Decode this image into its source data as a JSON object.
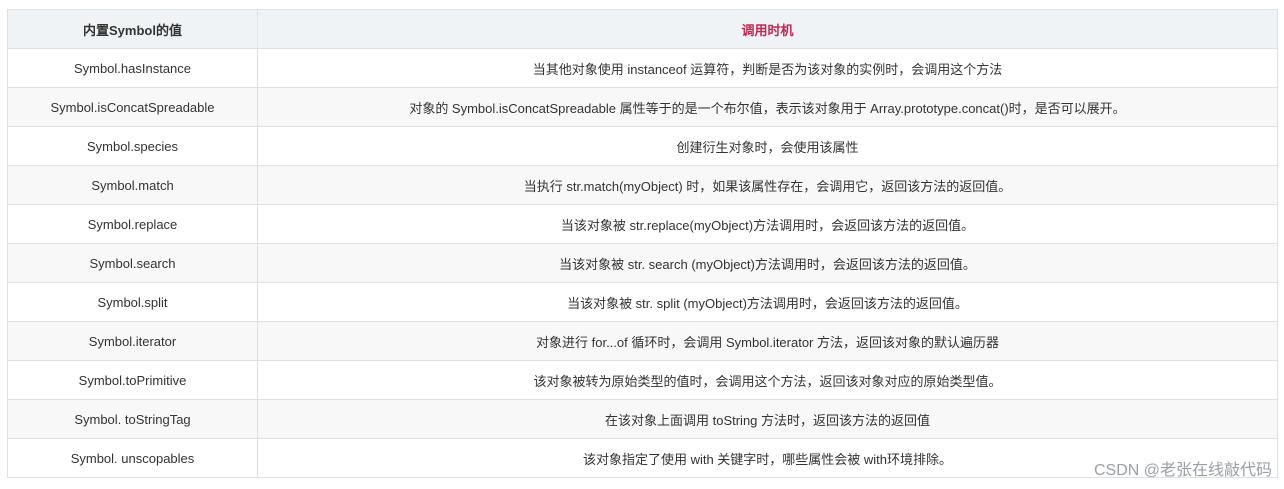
{
  "table": {
    "headers": [
      "内置Symbol的值",
      "调用时机"
    ],
    "accent_color": "#c7254e",
    "rows": [
      [
        "Symbol.hasInstance",
        "当其他对象使用 instanceof 运算符，判断是否为该对象的实例时，会调用这个方法"
      ],
      [
        "Symbol.isConcatSpreadable",
        "对象的 Symbol.isConcatSpreadable 属性等于的是一个布尔值，表示该对象用于 Array.prototype.concat()时，是否可以展开。"
      ],
      [
        "Symbol.species",
        "创建衍生对象时，会使用该属性"
      ],
      [
        "Symbol.match",
        "当执行 str.match(myObject) 时，如果该属性存在，会调用它，返回该方法的返回值。"
      ],
      [
        "Symbol.replace",
        "当该对象被 str.replace(myObject)方法调用时，会返回该方法的返回值。"
      ],
      [
        "Symbol.search",
        "当该对象被 str. search (myObject)方法调用时，会返回该方法的返回值。"
      ],
      [
        "Symbol.split",
        "当该对象被 str. split (myObject)方法调用时，会返回该方法的返回值。"
      ],
      [
        "Symbol.iterator",
        "对象进行 for...of 循环时，会调用 Symbol.iterator 方法，返回该对象的默认遍历器"
      ],
      [
        "Symbol.toPrimitive",
        "该对象被转为原始类型的值时，会调用这个方法，返回该对象对应的原始类型值。"
      ],
      [
        "Symbol. toStringTag",
        "在该对象上面调用 toString 方法时，返回该方法的返回值"
      ],
      [
        "Symbol. unscopables",
        "该对象指定了使用 with 关键字时，哪些属性会被 with环境排除。"
      ]
    ]
  },
  "watermark": "CSDN @老张在线敲代码"
}
